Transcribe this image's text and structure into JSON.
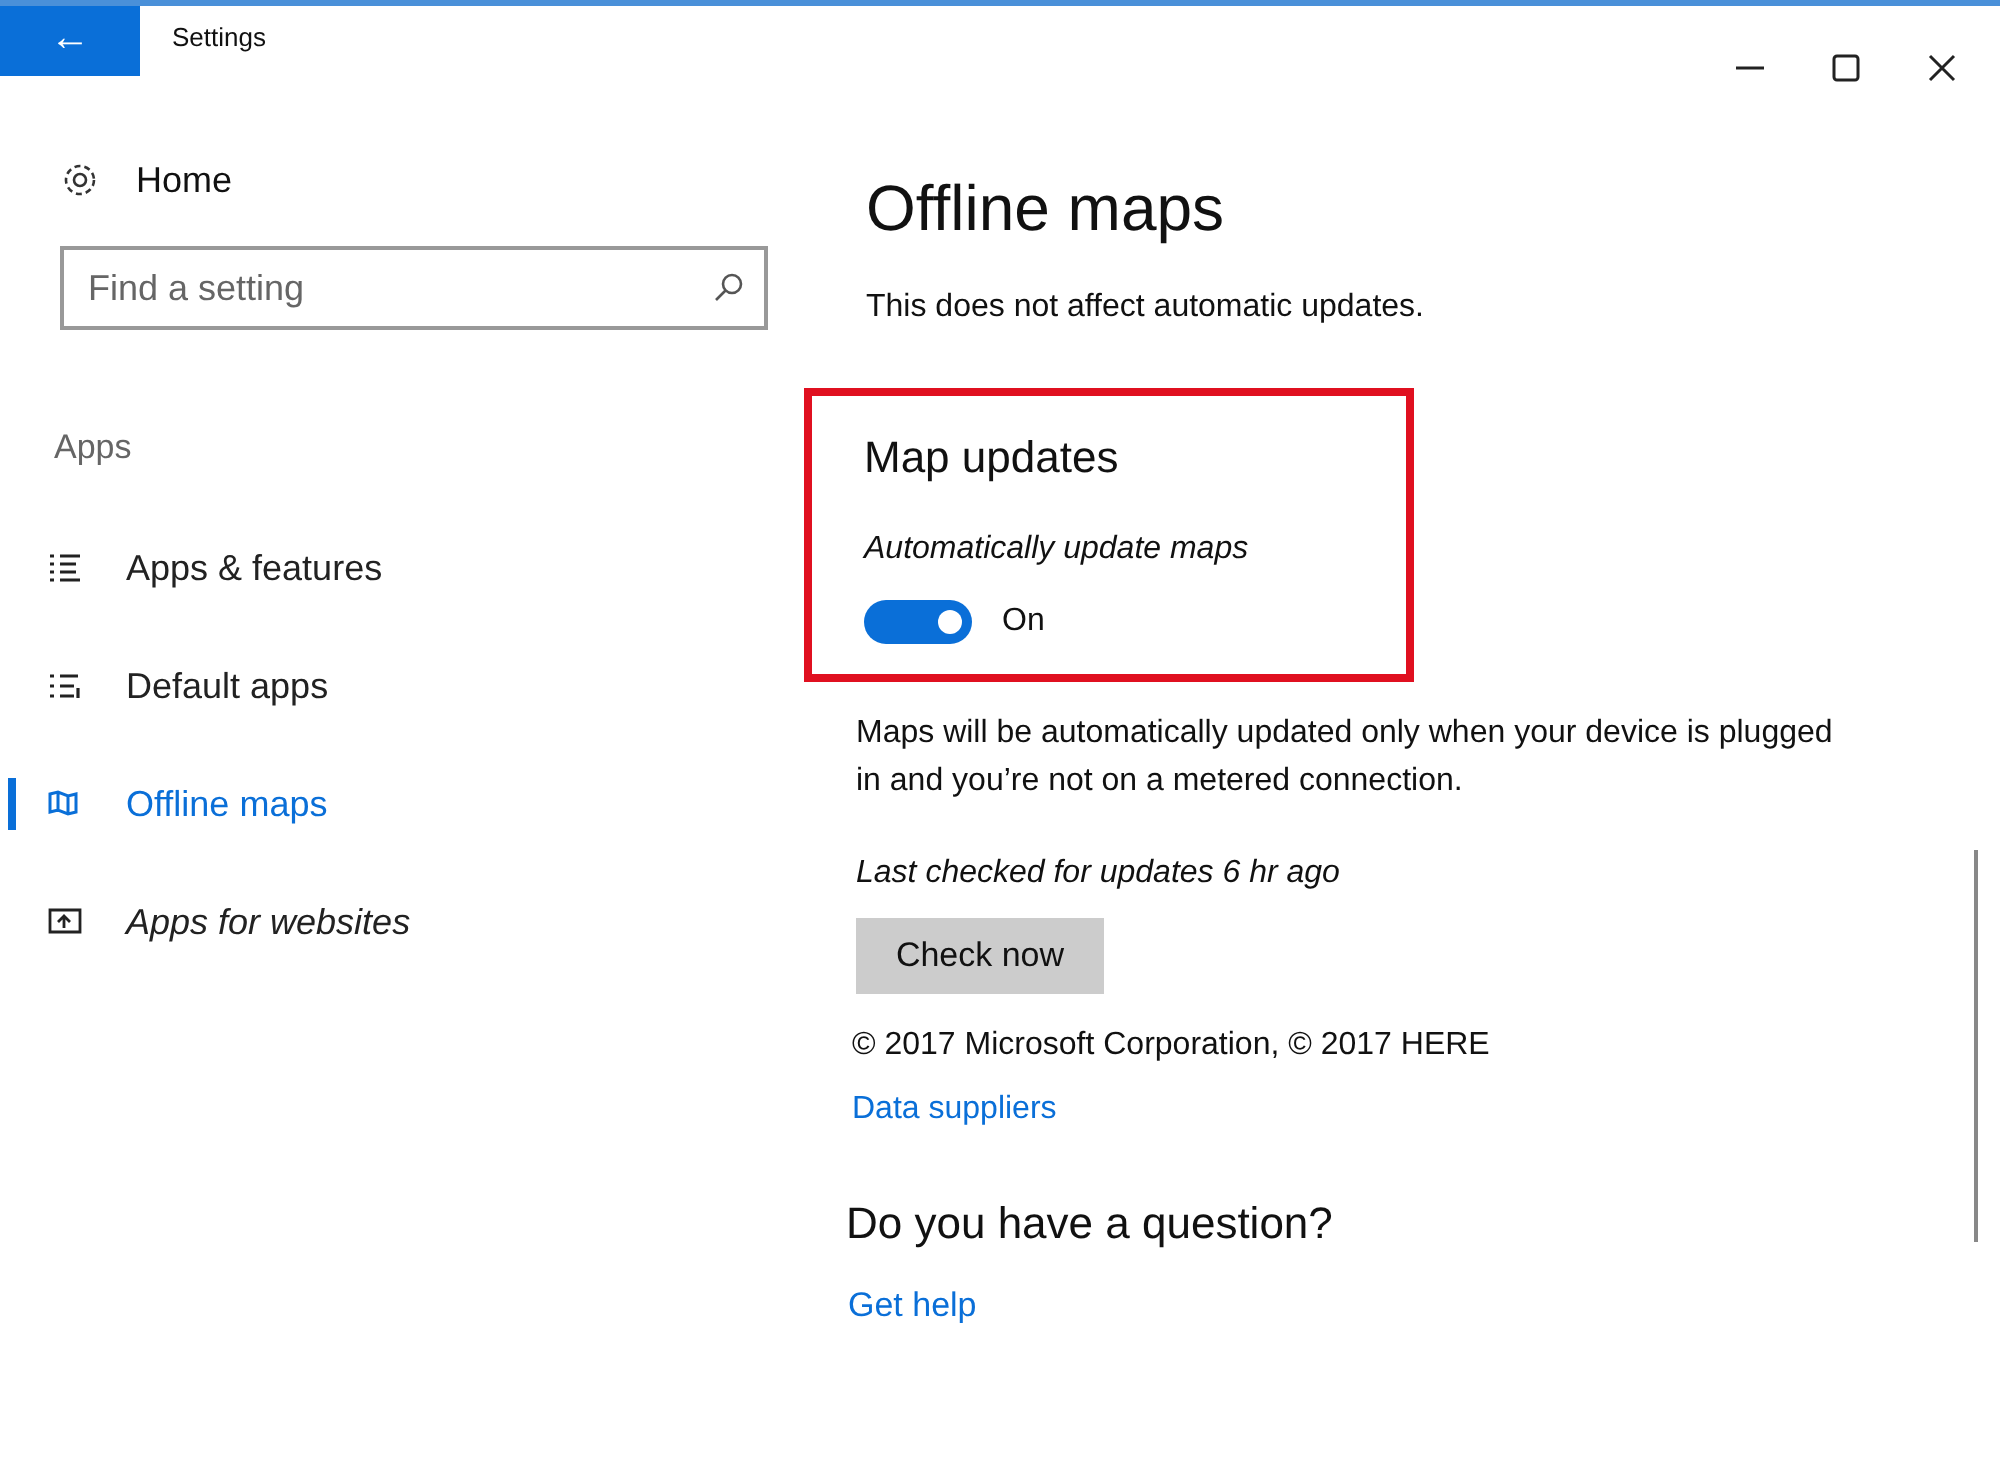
{
  "window": {
    "title": "Settings",
    "back": "←"
  },
  "sidebar": {
    "home": "Home",
    "search": {
      "placeholder": "Find a setting"
    },
    "section": "Apps",
    "items": [
      {
        "label": "Apps & features",
        "kind": "list",
        "selected": false
      },
      {
        "label": "Default apps",
        "kind": "defaults",
        "selected": false
      },
      {
        "label": "Offline maps",
        "kind": "map",
        "selected": true
      },
      {
        "label": "Apps for websites",
        "kind": "web",
        "selected": false
      }
    ]
  },
  "content": {
    "title": "Offline maps",
    "note": "This does not affect automatic updates.",
    "map_updates": {
      "heading": "Map updates",
      "toggle_label": "Automatically update maps",
      "on": true,
      "state_text": "On"
    },
    "description": "Maps will be automatically updated only when your device is plugged in and you’re not on a metered connection.",
    "last_checked": "Last checked for updates 6 hr ago",
    "check_button": "Check now",
    "copyright": "© 2017 Microsoft Corporation, © 2017 HERE",
    "suppliers_link": "Data suppliers",
    "question": "Do you have a question?",
    "help_link": "Get help"
  }
}
